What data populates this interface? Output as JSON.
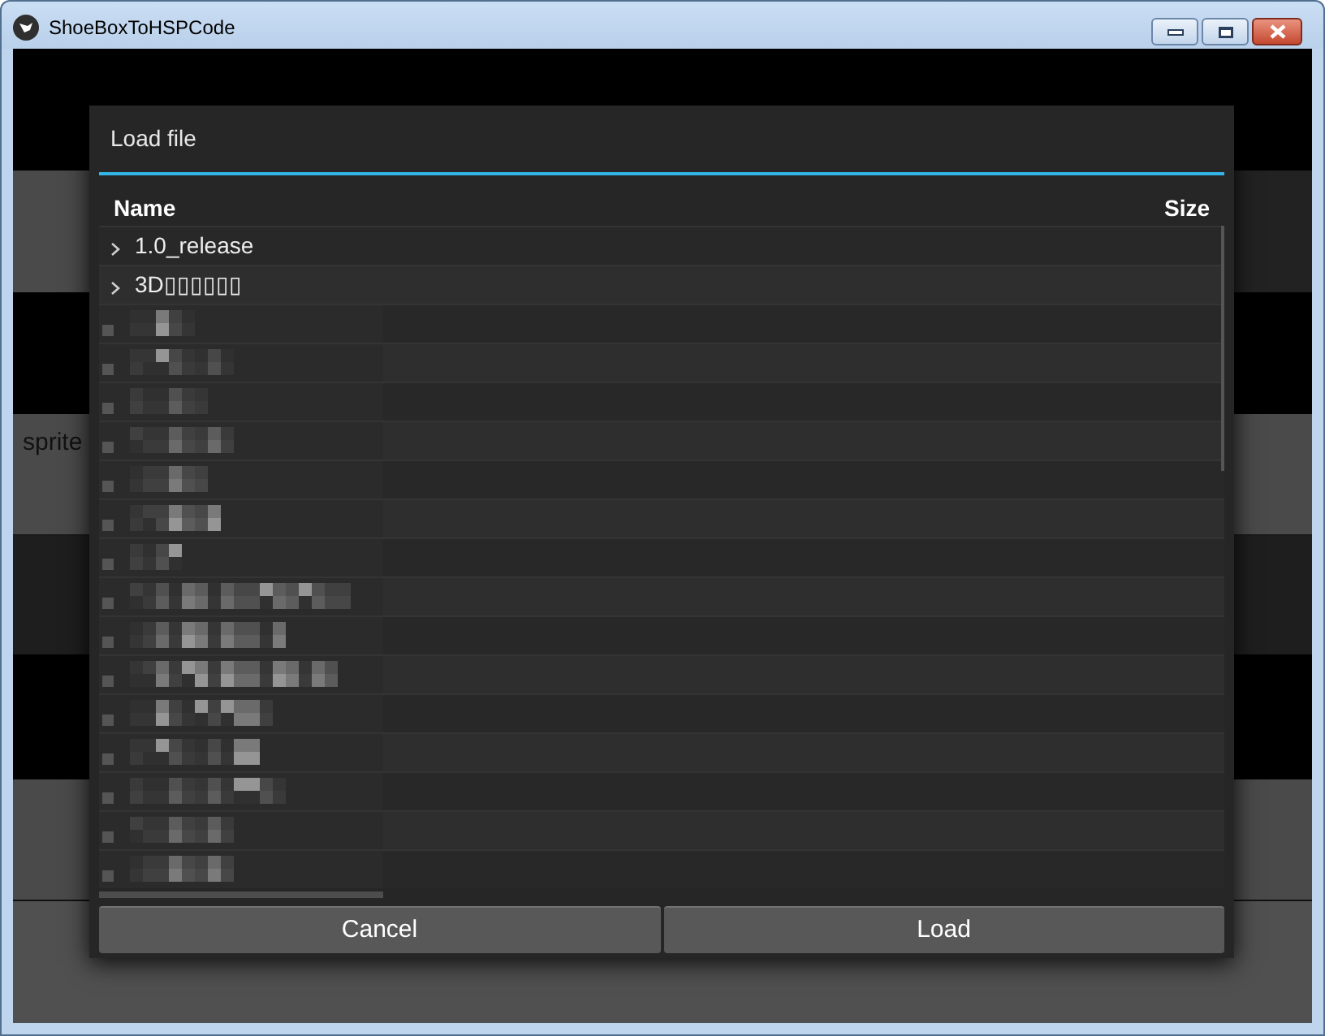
{
  "window": {
    "title": "ShoeBoxToHSPCode"
  },
  "background": {
    "label": "sprite"
  },
  "dialog": {
    "title": "Load file",
    "columns": [
      "Name",
      "Size"
    ],
    "rows": [
      {
        "kind": "folder",
        "name": "1.0_release"
      },
      {
        "kind": "folder",
        "name": "3D▯▯▯▯▯▯"
      },
      {
        "kind": "blurred"
      },
      {
        "kind": "blurred"
      },
      {
        "kind": "blurred"
      },
      {
        "kind": "blurred"
      },
      {
        "kind": "blurred"
      },
      {
        "kind": "blurred"
      },
      {
        "kind": "blurred"
      },
      {
        "kind": "blurred"
      },
      {
        "kind": "blurred"
      },
      {
        "kind": "blurred"
      },
      {
        "kind": "blurred"
      },
      {
        "kind": "blurred"
      },
      {
        "kind": "blurred"
      },
      {
        "kind": "blurred"
      },
      {
        "kind": "blurred"
      }
    ],
    "buttons": [
      "Cancel",
      "Load"
    ]
  }
}
